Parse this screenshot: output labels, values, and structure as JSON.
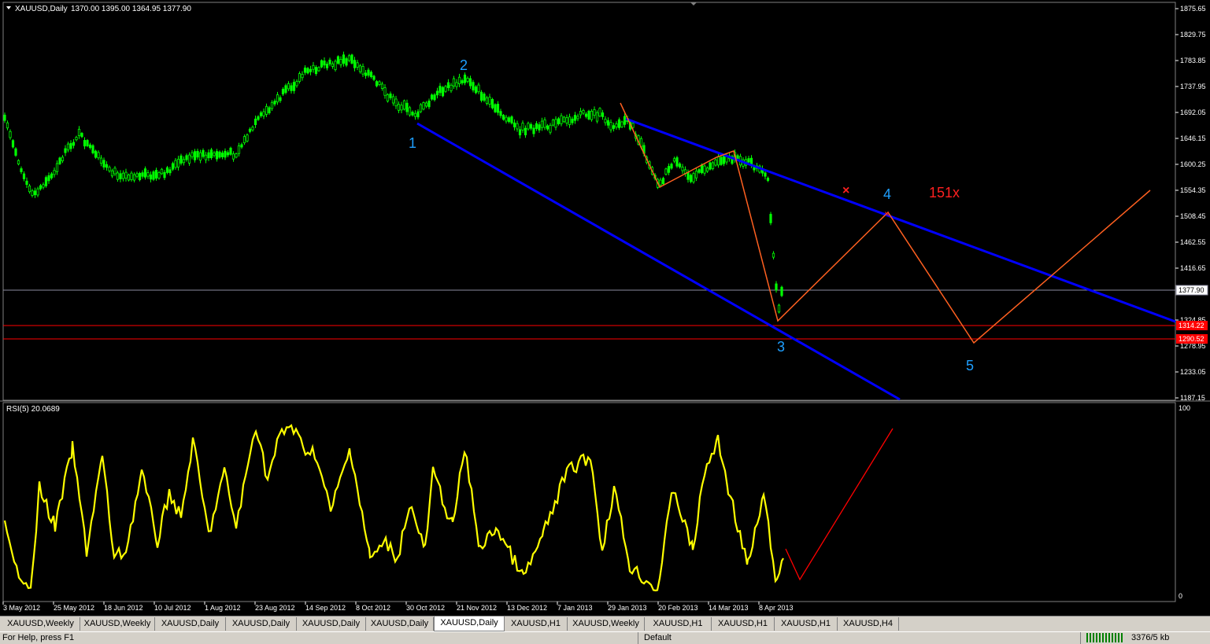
{
  "header": {
    "symbol_title": "XAUUSD,Daily",
    "ohlc": "1370.00 1395.00 1364.95 1377.90",
    "rsi_title": "RSI(5) 20.0689"
  },
  "price_axis": {
    "ticks": [
      "1875.65",
      "1829.75",
      "1783.85",
      "1737.95",
      "1692.05",
      "1646.15",
      "1600.25",
      "1554.35",
      "1508.45",
      "1462.55",
      "1416.65",
      "1324.85",
      "1278.95",
      "1233.05",
      "1187.15"
    ],
    "current_price": "1377.90",
    "level_1": "1314.22",
    "level_2": "1290.52"
  },
  "rsi_axis": {
    "top": "100",
    "bottom": "0"
  },
  "time_axis": {
    "labels": [
      "3 May 2012",
      "25 May 2012",
      "18 Jun 2012",
      "10 Jul 2012",
      "1 Aug 2012",
      "23 Aug 2012",
      "14 Sep 2012",
      "8 Oct 2012",
      "30 Oct 2012",
      "21 Nov 2012",
      "13 Dec 2012",
      "7 Jan 2013",
      "29 Jan 2013",
      "20 Feb 2013",
      "14 Mar 2013",
      "8 Apr 2013"
    ]
  },
  "annotations": {
    "wave_1": "1",
    "wave_2": "2",
    "wave_3": "3",
    "wave_4": "4",
    "wave_5": "5",
    "red_label": "151x",
    "cross_marker": "×"
  },
  "colors": {
    "candles": "#00ff00",
    "trendlines": "#0000ff",
    "projection": "#ff6020",
    "levels": "#ff0000",
    "rsi": "#ffff00",
    "wave_labels": "#1e9fff"
  },
  "tabs": [
    {
      "label": "XAUUSD,Weekly",
      "active": false
    },
    {
      "label": "XAUUSD,Weekly",
      "active": false
    },
    {
      "label": "XAUUSD,Daily",
      "active": false
    },
    {
      "label": "XAUUSD,Daily",
      "active": false
    },
    {
      "label": "XAUUSD,Daily",
      "active": false
    },
    {
      "label": "XAUUSD,Daily",
      "active": false
    },
    {
      "label": "XAUUSD,Daily",
      "active": true
    },
    {
      "label": "XAUUSD,H1",
      "active": false
    },
    {
      "label": "XAUUSD,Weekly",
      "active": false
    },
    {
      "label": "XAUUSD,H1",
      "active": false
    },
    {
      "label": "XAUUSD,H1",
      "active": false
    },
    {
      "label": "XAUUSD,H1",
      "active": false
    },
    {
      "label": "XAUUSD,H4",
      "active": false
    }
  ],
  "status_bar": {
    "help": "For Help, press F1",
    "profile": "Default",
    "traffic": "3376/5 kb"
  }
}
